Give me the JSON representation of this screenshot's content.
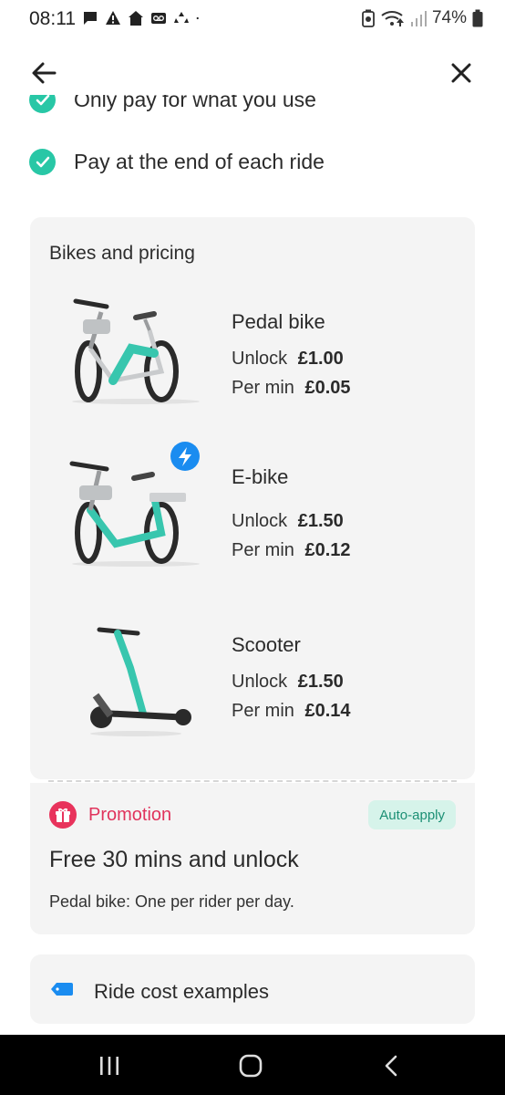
{
  "status": {
    "time": "08:11",
    "battery": "74%",
    "left_icons": [
      "message-icon",
      "warning-icon",
      "home-icon",
      "voicemail-icon",
      "recycle-icon",
      "dot-icon"
    ],
    "right_icons": [
      "battery-saver-icon",
      "wifi-icon",
      "signal-icon",
      "battery-icon"
    ]
  },
  "header": {
    "back_icon": "arrow-left-icon",
    "close_icon": "close-icon"
  },
  "benefits": [
    {
      "text": "Only pay for what you use"
    },
    {
      "text": "Pay at the end of each ride"
    }
  ],
  "pricing": {
    "title": "Bikes and pricing",
    "vehicles": [
      {
        "name": "Pedal bike",
        "unlock_label": "Unlock",
        "unlock_price": "£1.00",
        "permin_label": "Per min",
        "permin_price": "£0.05",
        "image": "pedal-bike-image"
      },
      {
        "name": "E-bike",
        "unlock_label": "Unlock",
        "unlock_price": "£1.50",
        "permin_label": "Per min",
        "permin_price": "£0.12",
        "image": "e-bike-image",
        "badge_icon": "lightning-icon"
      },
      {
        "name": "Scooter",
        "unlock_label": "Unlock",
        "unlock_price": "£1.50",
        "permin_label": "Per min",
        "permin_price": "£0.14",
        "image": "scooter-image"
      }
    ]
  },
  "promotion": {
    "label": "Promotion",
    "badge": "Auto-apply",
    "title": "Free 30 mins and unlock",
    "subtitle": "Pedal bike: One per rider per day.",
    "icon": "gift-icon"
  },
  "ride_cost": {
    "label": "Ride cost examples",
    "icon": "tag-icon"
  },
  "colors": {
    "accent": "#28c7a6",
    "promo": "#e0335c",
    "badge_bg": "#d6f3ea",
    "card_bg": "#f4f4f4",
    "bolt_blue": "#1a8cf0"
  },
  "nav": {
    "recents_icon": "recents-icon",
    "home_icon": "home-button-icon",
    "back_icon": "nav-back-icon"
  }
}
